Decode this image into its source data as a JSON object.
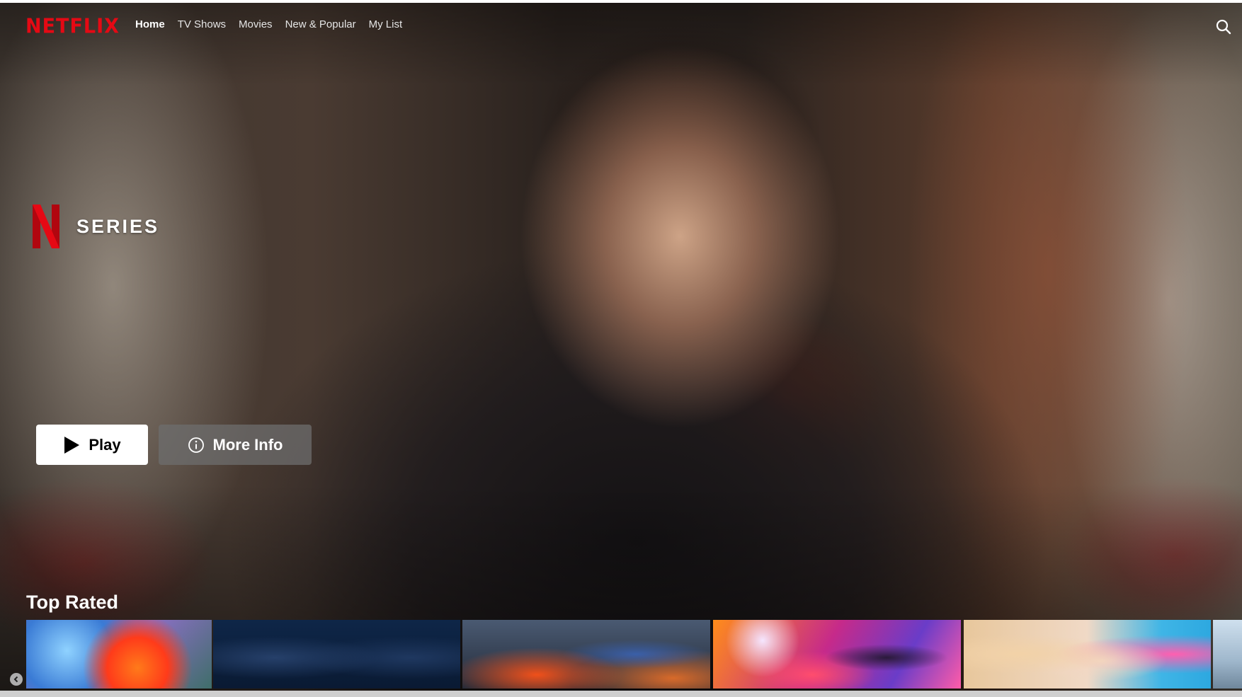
{
  "nav": {
    "logo": "NETFLIX",
    "links": [
      "Home",
      "TV Shows",
      "Movies",
      "New & Popular",
      "My List"
    ],
    "active": "Home",
    "search_icon": "search-icon"
  },
  "hero": {
    "badge_label": "SERIES",
    "play_label": "Play",
    "more_info_label": "More Info"
  },
  "row": {
    "title": "Top Rated",
    "tiles": [
      {
        "name": "elemental"
      },
      {
        "name": "underwater-divers"
      },
      {
        "name": "the-flash"
      },
      {
        "name": "spider-verse"
      },
      {
        "name": "barbie"
      },
      {
        "name": "seaside"
      }
    ]
  },
  "colors": {
    "brand_red": "#e50914",
    "play_bg": "#ffffff",
    "more_info_bg": "#6d6d6e"
  }
}
